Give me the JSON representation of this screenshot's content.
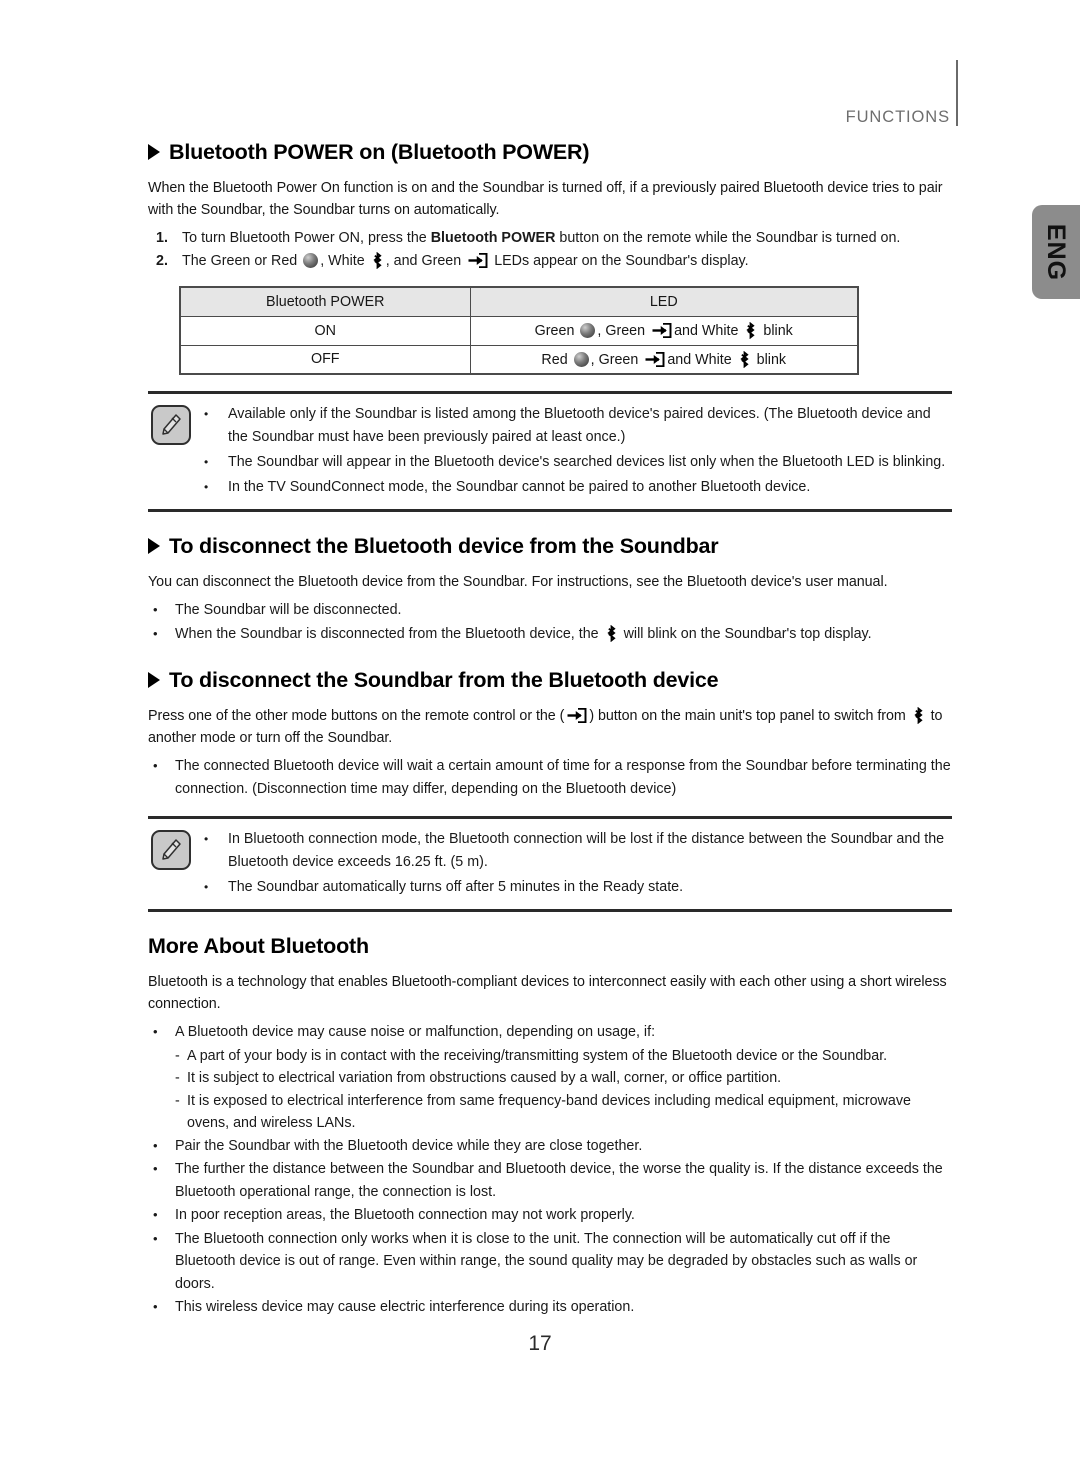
{
  "header": {
    "title": "FUNCTIONS",
    "language_tab": "ENG"
  },
  "page_number": "17",
  "sections": {
    "bt_power_on": {
      "heading": "Bluetooth POWER on (Bluetooth POWER)",
      "intro": "When the Bluetooth Power On function is on and the Soundbar is turned off, if a previously paired Bluetooth device tries to pair with the Soundbar, the Soundbar turns on automatically.",
      "steps": [
        {
          "num": "1.",
          "text_before": "To turn Bluetooth Power ON, press the ",
          "bold": "Bluetooth POWER",
          "text_after": " button on the remote while the Soundbar is turned on."
        },
        {
          "num": "2.",
          "part1": "The Green or Red",
          "part2": ", White",
          "part3": ", and Green",
          "part4": "LEDs appear on the Soundbar's display."
        }
      ],
      "table": {
        "headers": [
          "Bluetooth POWER",
          "LED"
        ],
        "rows": [
          {
            "state": "ON",
            "led_1": "Green",
            "led_2": ", Green",
            "led_3": "and White",
            "led_4": "blink"
          },
          {
            "state": "OFF",
            "led_1": "Red",
            "led_2": ", Green",
            "led_3": "and White",
            "led_4": "blink"
          }
        ]
      },
      "notes": [
        "Available only if the Soundbar is listed among the Bluetooth device's paired devices. (The Bluetooth device and the Soundbar must have been previously paired at least once.)",
        "The Soundbar will appear in the Bluetooth device's searched devices list only when the Bluetooth LED is blinking.",
        "In the TV SoundConnect mode, the Soundbar cannot be paired to another Bluetooth device."
      ]
    },
    "disconnect_device": {
      "heading": "To disconnect the Bluetooth device from the Soundbar",
      "intro": "You can disconnect the Bluetooth device from the Soundbar. For instructions, see the Bluetooth device's user manual.",
      "bullets": [
        {
          "text": "The Soundbar will be disconnected."
        },
        {
          "text_before": "When the Soundbar is disconnected from the Bluetooth device, the",
          "text_after": "will blink on the Soundbar's top display."
        }
      ]
    },
    "disconnect_soundbar": {
      "heading": "To disconnect the Soundbar from the Bluetooth device",
      "intro_part1": "Press one of the other mode buttons on the remote control or the (",
      "intro_part2": ") button on the main unit's top panel to switch from",
      "intro_part3": "to another mode or turn off the Soundbar.",
      "bullets": [
        "The connected Bluetooth device will wait a certain amount of time for a response from the Soundbar before terminating the connection. (Disconnection time may differ, depending on the Bluetooth device)"
      ],
      "notes": [
        "In Bluetooth connection mode, the Bluetooth connection will be lost if the distance between the Soundbar and the Bluetooth device exceeds 16.25 ft. (5 m).",
        "The Soundbar automatically turns off after 5 minutes in the Ready state."
      ]
    },
    "more_about": {
      "heading": "More About Bluetooth",
      "intro": "Bluetooth is a technology that enables Bluetooth-compliant devices to interconnect easily with each other using a short wireless connection.",
      "bullet_1": "A Bluetooth device may cause noise or malfunction, depending on usage, if:",
      "sub_bullets": [
        "A part of your body is in contact with the receiving/transmitting system of the Bluetooth device or the Soundbar.",
        "It is subject to electrical variation from obstructions caused by a wall, corner, or office partition.",
        "It is exposed to electrical interference from same frequency-band devices including medical equipment, microwave ovens, and wireless LANs."
      ],
      "bullets_rest": [
        "Pair the Soundbar with the Bluetooth device while they are close together.",
        "The further the distance between the Soundbar and Bluetooth device, the worse the quality is. If the distance exceeds the Bluetooth operational range, the connection is lost.",
        "In poor reception areas, the Bluetooth connection may not work properly.",
        "The Bluetooth connection only works when it is close to the unit. The connection will be automatically cut off if the Bluetooth device is out of range. Even within range, the sound quality may be degraded by obstacles such as walls or doors.",
        "This wireless device may cause electric interference during its operation."
      ]
    }
  },
  "icons": {
    "led": "led-indicator-icon",
    "bluetooth": "bluetooth-icon",
    "source": "source-input-icon",
    "note": "note-pencil-icon"
  },
  "colors": {
    "lang_tab_bg": "#8c8c8c",
    "table_header_bg": "#e6e6e6",
    "rule": "#2a2a2a",
    "header_text": "#6e6e6e"
  }
}
